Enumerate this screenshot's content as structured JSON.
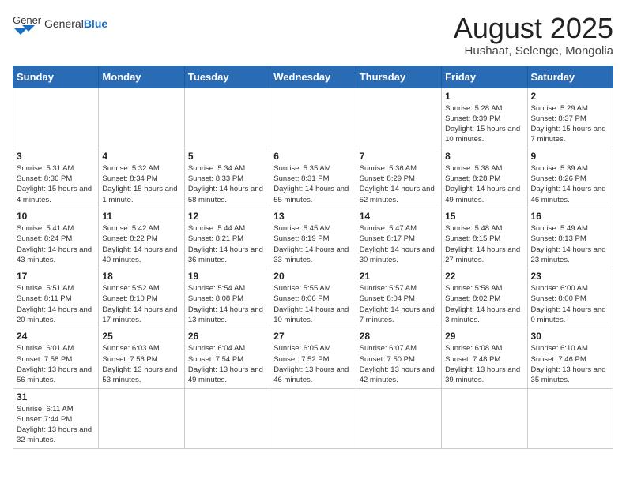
{
  "header": {
    "logo_general": "General",
    "logo_blue": "Blue",
    "title": "August 2025",
    "subtitle": "Hushaat, Selenge, Mongolia"
  },
  "weekdays": [
    "Sunday",
    "Monday",
    "Tuesday",
    "Wednesday",
    "Thursday",
    "Friday",
    "Saturday"
  ],
  "weeks": [
    [
      {
        "day": "",
        "info": ""
      },
      {
        "day": "",
        "info": ""
      },
      {
        "day": "",
        "info": ""
      },
      {
        "day": "",
        "info": ""
      },
      {
        "day": "",
        "info": ""
      },
      {
        "day": "1",
        "info": "Sunrise: 5:28 AM\nSunset: 8:39 PM\nDaylight: 15 hours and 10 minutes."
      },
      {
        "day": "2",
        "info": "Sunrise: 5:29 AM\nSunset: 8:37 PM\nDaylight: 15 hours and 7 minutes."
      }
    ],
    [
      {
        "day": "3",
        "info": "Sunrise: 5:31 AM\nSunset: 8:36 PM\nDaylight: 15 hours and 4 minutes."
      },
      {
        "day": "4",
        "info": "Sunrise: 5:32 AM\nSunset: 8:34 PM\nDaylight: 15 hours and 1 minute."
      },
      {
        "day": "5",
        "info": "Sunrise: 5:34 AM\nSunset: 8:33 PM\nDaylight: 14 hours and 58 minutes."
      },
      {
        "day": "6",
        "info": "Sunrise: 5:35 AM\nSunset: 8:31 PM\nDaylight: 14 hours and 55 minutes."
      },
      {
        "day": "7",
        "info": "Sunrise: 5:36 AM\nSunset: 8:29 PM\nDaylight: 14 hours and 52 minutes."
      },
      {
        "day": "8",
        "info": "Sunrise: 5:38 AM\nSunset: 8:28 PM\nDaylight: 14 hours and 49 minutes."
      },
      {
        "day": "9",
        "info": "Sunrise: 5:39 AM\nSunset: 8:26 PM\nDaylight: 14 hours and 46 minutes."
      }
    ],
    [
      {
        "day": "10",
        "info": "Sunrise: 5:41 AM\nSunset: 8:24 PM\nDaylight: 14 hours and 43 minutes."
      },
      {
        "day": "11",
        "info": "Sunrise: 5:42 AM\nSunset: 8:22 PM\nDaylight: 14 hours and 40 minutes."
      },
      {
        "day": "12",
        "info": "Sunrise: 5:44 AM\nSunset: 8:21 PM\nDaylight: 14 hours and 36 minutes."
      },
      {
        "day": "13",
        "info": "Sunrise: 5:45 AM\nSunset: 8:19 PM\nDaylight: 14 hours and 33 minutes."
      },
      {
        "day": "14",
        "info": "Sunrise: 5:47 AM\nSunset: 8:17 PM\nDaylight: 14 hours and 30 minutes."
      },
      {
        "day": "15",
        "info": "Sunrise: 5:48 AM\nSunset: 8:15 PM\nDaylight: 14 hours and 27 minutes."
      },
      {
        "day": "16",
        "info": "Sunrise: 5:49 AM\nSunset: 8:13 PM\nDaylight: 14 hours and 23 minutes."
      }
    ],
    [
      {
        "day": "17",
        "info": "Sunrise: 5:51 AM\nSunset: 8:11 PM\nDaylight: 14 hours and 20 minutes."
      },
      {
        "day": "18",
        "info": "Sunrise: 5:52 AM\nSunset: 8:10 PM\nDaylight: 14 hours and 17 minutes."
      },
      {
        "day": "19",
        "info": "Sunrise: 5:54 AM\nSunset: 8:08 PM\nDaylight: 14 hours and 13 minutes."
      },
      {
        "day": "20",
        "info": "Sunrise: 5:55 AM\nSunset: 8:06 PM\nDaylight: 14 hours and 10 minutes."
      },
      {
        "day": "21",
        "info": "Sunrise: 5:57 AM\nSunset: 8:04 PM\nDaylight: 14 hours and 7 minutes."
      },
      {
        "day": "22",
        "info": "Sunrise: 5:58 AM\nSunset: 8:02 PM\nDaylight: 14 hours and 3 minutes."
      },
      {
        "day": "23",
        "info": "Sunrise: 6:00 AM\nSunset: 8:00 PM\nDaylight: 14 hours and 0 minutes."
      }
    ],
    [
      {
        "day": "24",
        "info": "Sunrise: 6:01 AM\nSunset: 7:58 PM\nDaylight: 13 hours and 56 minutes."
      },
      {
        "day": "25",
        "info": "Sunrise: 6:03 AM\nSunset: 7:56 PM\nDaylight: 13 hours and 53 minutes."
      },
      {
        "day": "26",
        "info": "Sunrise: 6:04 AM\nSunset: 7:54 PM\nDaylight: 13 hours and 49 minutes."
      },
      {
        "day": "27",
        "info": "Sunrise: 6:05 AM\nSunset: 7:52 PM\nDaylight: 13 hours and 46 minutes."
      },
      {
        "day": "28",
        "info": "Sunrise: 6:07 AM\nSunset: 7:50 PM\nDaylight: 13 hours and 42 minutes."
      },
      {
        "day": "29",
        "info": "Sunrise: 6:08 AM\nSunset: 7:48 PM\nDaylight: 13 hours and 39 minutes."
      },
      {
        "day": "30",
        "info": "Sunrise: 6:10 AM\nSunset: 7:46 PM\nDaylight: 13 hours and 35 minutes."
      }
    ],
    [
      {
        "day": "31",
        "info": "Sunrise: 6:11 AM\nSunset: 7:44 PM\nDaylight: 13 hours and 32 minutes."
      },
      {
        "day": "",
        "info": ""
      },
      {
        "day": "",
        "info": ""
      },
      {
        "day": "",
        "info": ""
      },
      {
        "day": "",
        "info": ""
      },
      {
        "day": "",
        "info": ""
      },
      {
        "day": "",
        "info": ""
      }
    ]
  ]
}
